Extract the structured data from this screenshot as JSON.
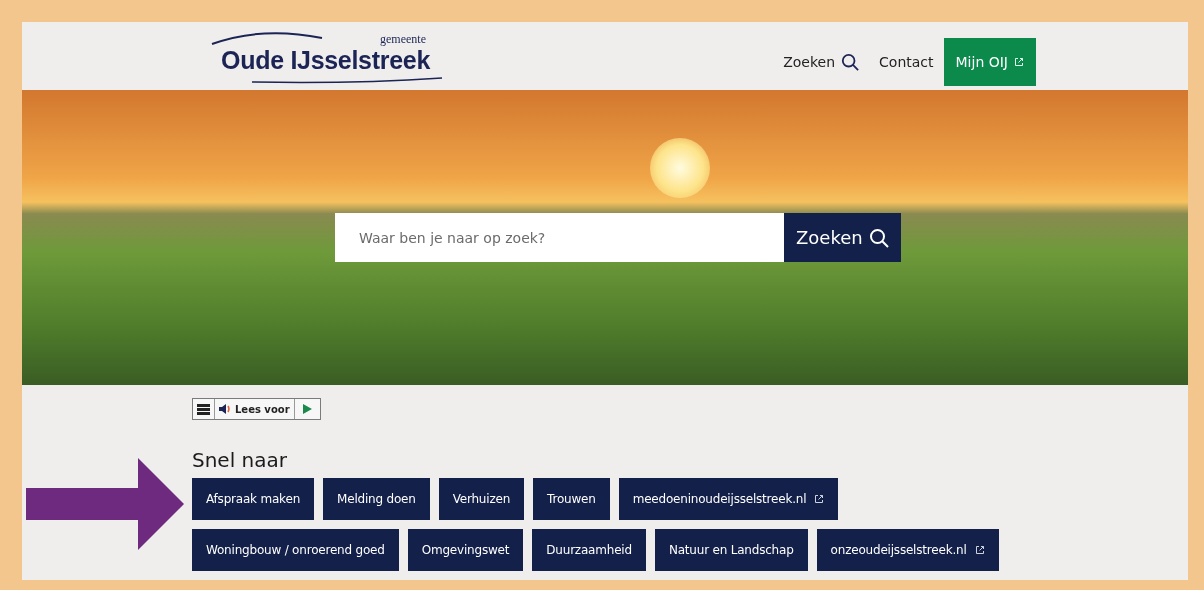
{
  "header": {
    "logo": {
      "small": "gemeente",
      "name": "Oude IJsselstreek"
    },
    "nav": [
      {
        "label": "Zoeken",
        "kind": "search"
      },
      {
        "label": "Contact",
        "kind": "link"
      },
      {
        "label": "Mijn OIJ",
        "kind": "external"
      }
    ]
  },
  "hero": {
    "search": {
      "placeholder": "Waar ben je naar op zoek?",
      "button": "Zoeken"
    }
  },
  "readspeaker": {
    "label": "Lees voor"
  },
  "quick_links": {
    "title": "Snel naar",
    "items": [
      {
        "label": "Afspraak maken",
        "external": false
      },
      {
        "label": "Melding doen",
        "external": false
      },
      {
        "label": "Verhuizen",
        "external": false
      },
      {
        "label": "Trouwen",
        "external": false
      },
      {
        "label": "meedoeninoudeijsselstreek.nl",
        "external": true
      },
      {
        "label": "Woningbouw / onroerend goed",
        "external": false
      },
      {
        "label": "Omgevingswet",
        "external": false
      },
      {
        "label": "Duurzaamheid",
        "external": false
      },
      {
        "label": "Natuur en Landschap",
        "external": false
      },
      {
        "label": "onzeoudeijsselstreek.nl",
        "external": true
      }
    ]
  }
}
